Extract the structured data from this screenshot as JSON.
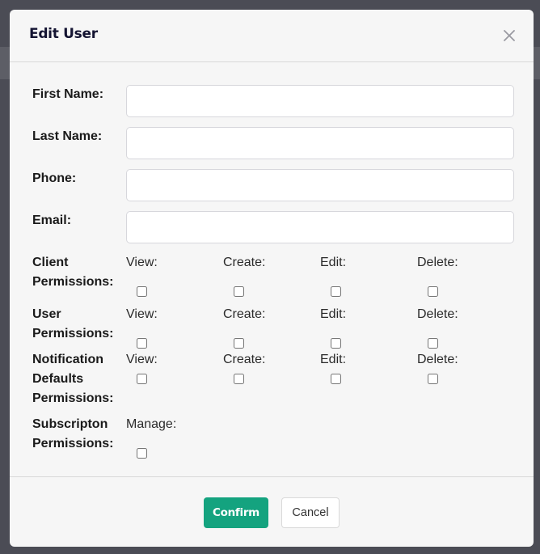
{
  "modal": {
    "title": "Edit User",
    "close_icon": "close-icon"
  },
  "fields": [
    {
      "label": "First Name:",
      "value": "",
      "placeholder": ""
    },
    {
      "label": "Last Name:",
      "value": "",
      "placeholder": ""
    },
    {
      "label": "Phone:",
      "value": "",
      "placeholder": ""
    },
    {
      "label": "Email:",
      "value": "",
      "placeholder": ""
    }
  ],
  "permissions": {
    "client": {
      "label_line1": "Client",
      "label_line2": "Permissions:"
    },
    "user": {
      "label_line1": "User",
      "label_line2": "Permissions:"
    },
    "notification": {
      "label_line1": "Notification",
      "label_line2": "Defaults",
      "label_line3": "Permissions:"
    },
    "subscription": {
      "label_line1": "Subscripton",
      "label_line2": "Permissions:"
    },
    "actions": {
      "view": "View:",
      "create": "Create:",
      "edit": "Edit:",
      "delete": "Delete:",
      "manage": "Manage:"
    },
    "checked": {
      "client": {
        "view": false,
        "create": false,
        "edit": false,
        "delete": false
      },
      "user": {
        "view": false,
        "create": false,
        "edit": false,
        "delete": false
      },
      "notification": {
        "view": false,
        "create": false,
        "edit": false,
        "delete": false
      },
      "subscription": {
        "manage": false
      }
    }
  },
  "footer": {
    "confirm_label": "Confirm",
    "cancel_label": "Cancel"
  },
  "colors": {
    "accent": "#14a37f",
    "overlay": "#4b4c55",
    "title": "#141432"
  }
}
